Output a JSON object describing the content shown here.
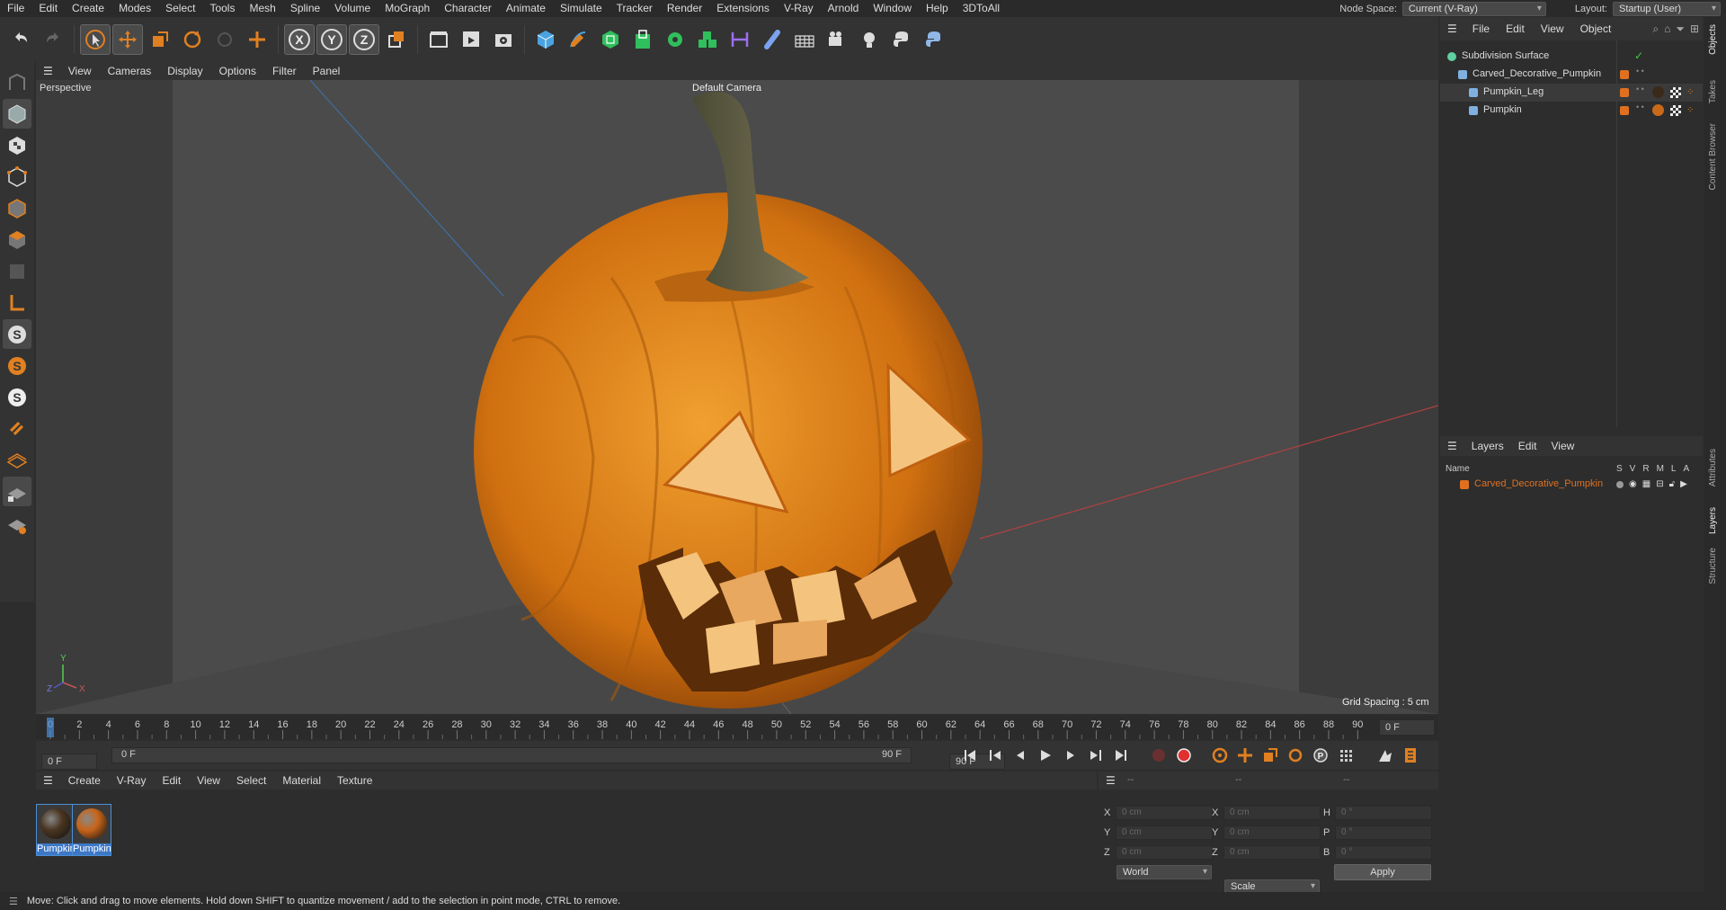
{
  "menu": [
    "File",
    "Edit",
    "Create",
    "Modes",
    "Select",
    "Tools",
    "Mesh",
    "Spline",
    "Volume",
    "MoGraph",
    "Character",
    "Animate",
    "Simulate",
    "Tracker",
    "Render",
    "Extensions",
    "V-Ray",
    "Arnold",
    "Window",
    "Help",
    "3DToAll"
  ],
  "node_space": {
    "label": "Node Space:",
    "value": "Current (V-Ray)"
  },
  "layout": {
    "label": "Layout:",
    "value": "Startup (User)"
  },
  "viewport": {
    "menu": [
      "View",
      "Cameras",
      "Display",
      "Options",
      "Filter",
      "Panel"
    ],
    "projection": "Perspective",
    "camera": "Default Camera",
    "grid_spacing": "Grid Spacing : 5 cm"
  },
  "timeline": {
    "ticks": [
      "0",
      "2",
      "4",
      "6",
      "8",
      "10",
      "12",
      "14",
      "16",
      "18",
      "20",
      "22",
      "24",
      "26",
      "28",
      "30",
      "32",
      "34",
      "36",
      "38",
      "40",
      "42",
      "44",
      "46",
      "48",
      "50",
      "52",
      "54",
      "56",
      "58",
      "60",
      "62",
      "64",
      "66",
      "68",
      "70",
      "72",
      "74",
      "76",
      "78",
      "80",
      "82",
      "84",
      "86",
      "88",
      "90"
    ],
    "current_frame": "0 F",
    "start_frame": "0 F",
    "range_start": "0 F",
    "range_end": "90 F",
    "end_frame": "90 F"
  },
  "material_manager": {
    "menu": [
      "Create",
      "V-Ray",
      "Edit",
      "View",
      "Select",
      "Material",
      "Texture"
    ],
    "materials": [
      {
        "name": "Pumpkin",
        "color": "#4a3520"
      },
      {
        "name": "Pumpkin",
        "color": "#c8651a"
      }
    ]
  },
  "coordinates": {
    "headers": [
      "--",
      "--",
      "--"
    ],
    "rows": [
      {
        "a": "X",
        "av": "0 cm",
        "b": "X",
        "bv": "0 cm",
        "c": "H",
        "cv": "0 °"
      },
      {
        "a": "Y",
        "av": "0 cm",
        "b": "Y",
        "bv": "0 cm",
        "c": "P",
        "cv": "0 °"
      },
      {
        "a": "Z",
        "av": "0 cm",
        "b": "Z",
        "bv": "0 cm",
        "c": "B",
        "cv": "0 °"
      }
    ],
    "space": "World",
    "mode": "Scale",
    "apply": "Apply"
  },
  "objects_panel": {
    "menu": [
      "File",
      "Edit",
      "View",
      "Object"
    ],
    "items": [
      {
        "name": "Subdivision Surface",
        "level": 0
      },
      {
        "name": "Carved_Decorative_Pumpkin",
        "level": 1
      },
      {
        "name": "Pumpkin_Leg",
        "level": 2
      },
      {
        "name": "Pumpkin",
        "level": 2
      }
    ]
  },
  "layers_panel": {
    "menu": [
      "Layers",
      "Edit",
      "View"
    ],
    "columns": {
      "name": "Name",
      "flags": [
        "S",
        "V",
        "R",
        "M",
        "L",
        "A"
      ]
    },
    "layers": [
      {
        "name": "Carved_Decorative_Pumpkin",
        "color": "#e07020"
      }
    ]
  },
  "right_tabs": [
    "Objects",
    "Takes",
    "Content Browser",
    "Attributes",
    "Layers",
    "Structure"
  ],
  "status": "Move: Click and drag to move elements. Hold down SHIFT to quantize movement / add to the selection in point mode, CTRL to remove.",
  "colors": {
    "accent": "#e08020",
    "selection": "#3d78c7",
    "bg": "#2d2d2d"
  }
}
